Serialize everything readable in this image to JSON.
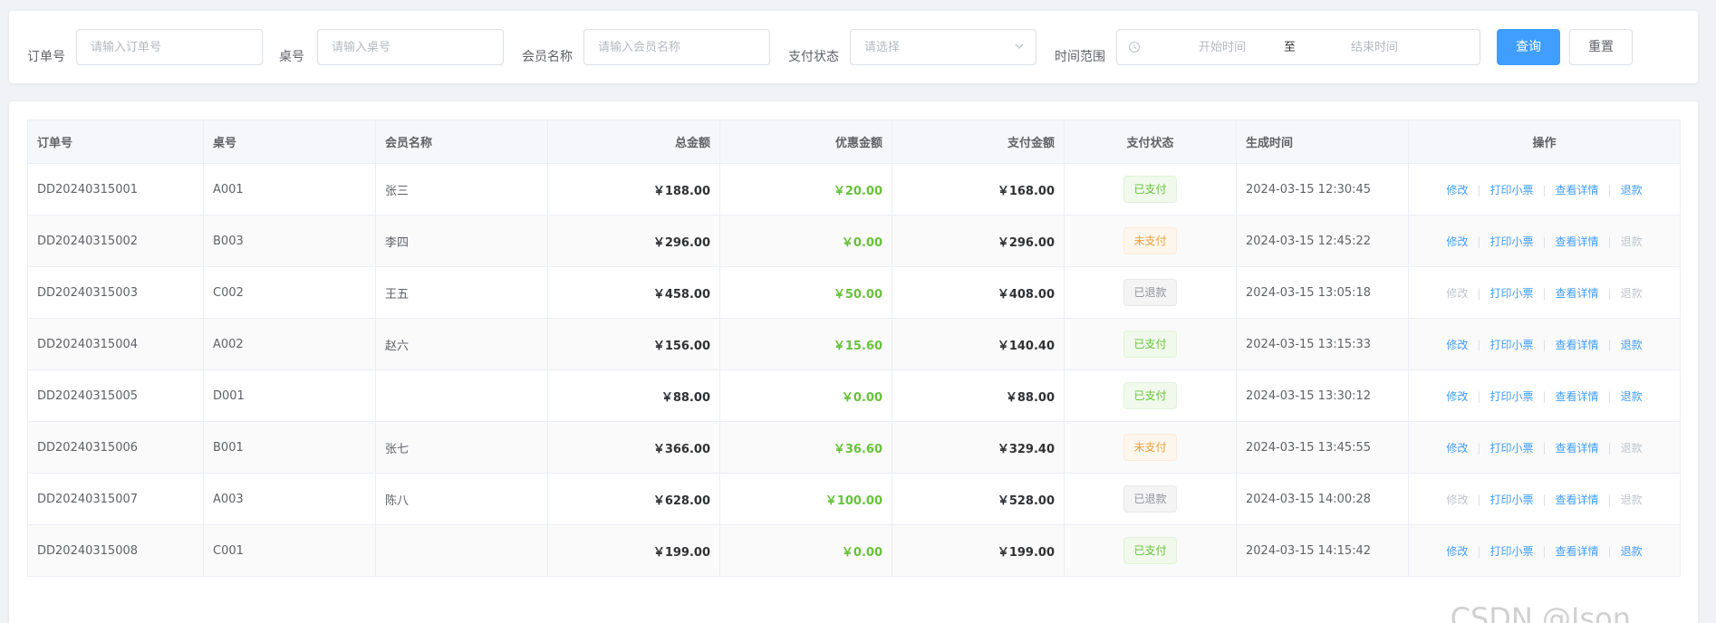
{
  "filters": {
    "order_no": {
      "label": "订单号",
      "placeholder": "请输入订单号"
    },
    "table_no": {
      "label": "桌号",
      "placeholder": "请输入桌号"
    },
    "member_name": {
      "label": "会员名称",
      "placeholder": "请输入会员名称"
    },
    "pay_status": {
      "label": "支付状态",
      "placeholder": "请选择"
    },
    "time_range": {
      "label": "时间范围",
      "start_placeholder": "开始时间",
      "separator": "至",
      "end_placeholder": "结束时间"
    },
    "query_label": "查询",
    "reset_label": "重置"
  },
  "table": {
    "headers": [
      "订单号",
      "桌号",
      "会员名称",
      "总金额",
      "优惠金额",
      "支付金额",
      "支付状态",
      "生成时间",
      "操作"
    ],
    "rows": [
      {
        "order_no": "DD20240315001",
        "table_no": "A001",
        "member": "张三",
        "total": "￥188.00",
        "discount": "￥20.00",
        "paid": "￥168.00",
        "status": "已支付",
        "status_type": "paid",
        "created": "2024-03-15 12:30:45",
        "ops": [
          {
            "label": "修改",
            "enabled": true
          },
          {
            "label": "打印小票",
            "enabled": true
          },
          {
            "label": "查看详情",
            "enabled": true
          },
          {
            "label": "退款",
            "enabled": true
          }
        ]
      },
      {
        "order_no": "DD20240315002",
        "table_no": "B003",
        "member": "李四",
        "total": "￥296.00",
        "discount": "￥0.00",
        "paid": "￥296.00",
        "status": "未支付",
        "status_type": "unpaid",
        "created": "2024-03-15 12:45:22",
        "ops": [
          {
            "label": "修改",
            "enabled": true
          },
          {
            "label": "打印小票",
            "enabled": true
          },
          {
            "label": "查看详情",
            "enabled": true
          },
          {
            "label": "退款",
            "enabled": false
          }
        ]
      },
      {
        "order_no": "DD20240315003",
        "table_no": "C002",
        "member": "王五",
        "total": "￥458.00",
        "discount": "￥50.00",
        "paid": "￥408.00",
        "status": "已退款",
        "status_type": "refund",
        "created": "2024-03-15 13:05:18",
        "ops": [
          {
            "label": "修改",
            "enabled": false
          },
          {
            "label": "打印小票",
            "enabled": true
          },
          {
            "label": "查看详情",
            "enabled": true
          },
          {
            "label": "退款",
            "enabled": false
          }
        ]
      },
      {
        "order_no": "DD20240315004",
        "table_no": "A002",
        "member": "赵六",
        "total": "￥156.00",
        "discount": "￥15.60",
        "paid": "￥140.40",
        "status": "已支付",
        "status_type": "paid",
        "created": "2024-03-15 13:15:33",
        "ops": [
          {
            "label": "修改",
            "enabled": true
          },
          {
            "label": "打印小票",
            "enabled": true
          },
          {
            "label": "查看详情",
            "enabled": true
          },
          {
            "label": "退款",
            "enabled": true
          }
        ]
      },
      {
        "order_no": "DD20240315005",
        "table_no": "D001",
        "member": "",
        "total": "￥88.00",
        "discount": "￥0.00",
        "paid": "￥88.00",
        "status": "已支付",
        "status_type": "paid",
        "created": "2024-03-15 13:30:12",
        "ops": [
          {
            "label": "修改",
            "enabled": true
          },
          {
            "label": "打印小票",
            "enabled": true
          },
          {
            "label": "查看详情",
            "enabled": true
          },
          {
            "label": "退款",
            "enabled": true
          }
        ]
      },
      {
        "order_no": "DD20240315006",
        "table_no": "B001",
        "member": "张七",
        "total": "￥366.00",
        "discount": "￥36.60",
        "paid": "￥329.40",
        "status": "未支付",
        "status_type": "unpaid",
        "created": "2024-03-15 13:45:55",
        "ops": [
          {
            "label": "修改",
            "enabled": true
          },
          {
            "label": "打印小票",
            "enabled": true
          },
          {
            "label": "查看详情",
            "enabled": true
          },
          {
            "label": "退款",
            "enabled": false
          }
        ]
      },
      {
        "order_no": "DD20240315007",
        "table_no": "A003",
        "member": "陈八",
        "total": "￥628.00",
        "discount": "￥100.00",
        "paid": "￥528.00",
        "status": "已退款",
        "status_type": "refund",
        "created": "2024-03-15 14:00:28",
        "ops": [
          {
            "label": "修改",
            "enabled": false
          },
          {
            "label": "打印小票",
            "enabled": true
          },
          {
            "label": "查看详情",
            "enabled": true
          },
          {
            "label": "退款",
            "enabled": false
          }
        ]
      },
      {
        "order_no": "DD20240315008",
        "table_no": "C001",
        "member": "",
        "total": "￥199.00",
        "discount": "￥0.00",
        "paid": "￥199.00",
        "status": "已支付",
        "status_type": "paid",
        "created": "2024-03-15 14:15:42",
        "ops": [
          {
            "label": "修改",
            "enabled": true
          },
          {
            "label": "打印小票",
            "enabled": true
          },
          {
            "label": "查看详情",
            "enabled": true
          },
          {
            "label": "退款",
            "enabled": true
          }
        ]
      }
    ]
  },
  "watermark": "CSDN @Json____",
  "colors": {
    "primary": "#409eff",
    "success": "#67c23a",
    "warning": "#e6a23c",
    "info": "#909399"
  },
  "icons": {
    "clock": "clock-icon",
    "arrow": "chevron-down-icon"
  }
}
